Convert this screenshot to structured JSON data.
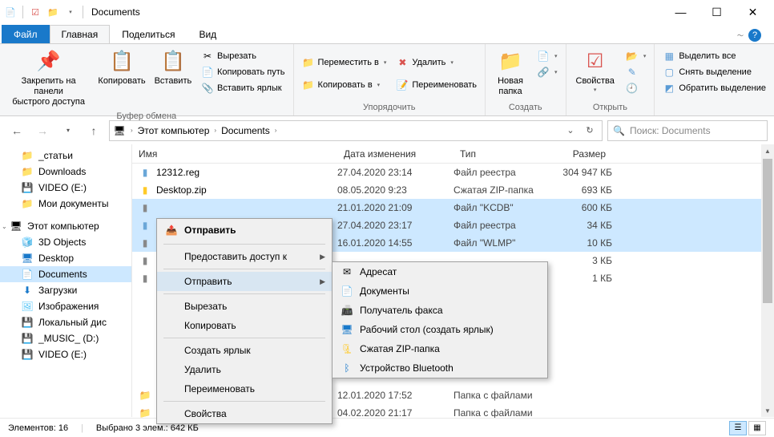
{
  "title": "Documents",
  "tabs": {
    "file": "Файл",
    "home": "Главная",
    "share": "Поделиться",
    "view": "Вид"
  },
  "ribbon": {
    "g1": {
      "pin": "Закрепить на панели\nбыстрого доступа",
      "copy": "Копировать",
      "paste": "Вставить",
      "cut": "Вырезать",
      "copypath": "Копировать путь",
      "pastelink": "Вставить ярлык",
      "label": "Буфер обмена"
    },
    "g2": {
      "moveto": "Переместить в",
      "copyto": "Копировать в",
      "delete": "Удалить",
      "rename": "Переименовать",
      "label": "Упорядочить"
    },
    "g3": {
      "newfolder": "Новая\nпапка",
      "label": "Создать"
    },
    "g4": {
      "props": "Свойства",
      "label": "Открыть"
    },
    "g5": {
      "selall": "Выделить все",
      "selnone": "Снять выделение",
      "selinv": "Обратить выделение"
    }
  },
  "breadcrumb": {
    "pc": "Этот компьютер",
    "docs": "Documents"
  },
  "search_placeholder": "Поиск: Documents",
  "sidebar": {
    "items1": [
      "_статьи",
      "Downloads",
      "VIDEO (E:)",
      "Мои документы"
    ],
    "pc": "Этот компьютер",
    "items2": [
      "3D Objects",
      "Desktop",
      "Documents",
      "Загрузки",
      "Изображения",
      "Локальный дис",
      "_MUSIC_ (D:)",
      "VIDEO (E:)"
    ]
  },
  "headers": {
    "name": "Имя",
    "date": "Дата изменения",
    "type": "Тип",
    "size": "Размер"
  },
  "rows": [
    {
      "name": "12312.reg",
      "date": "27.04.2020 23:14",
      "type": "Файл реестра",
      "size": "304 947 КБ",
      "sel": false,
      "iconc": "#6aa7d8"
    },
    {
      "name": "Desktop.zip",
      "date": "08.05.2020 9:23",
      "type": "Сжатая ZIP-папка",
      "size": "693 КБ",
      "sel": false,
      "iconc": "#ffca28"
    },
    {
      "name": "",
      "date": "21.01.2020 21:09",
      "type": "Файл \"KCDB\"",
      "size": "600 КБ",
      "sel": true,
      "iconc": "#888"
    },
    {
      "name": "",
      "date": "27.04.2020 23:17",
      "type": "Файл реестра",
      "size": "34 КБ",
      "sel": true,
      "iconc": "#6aa7d8"
    },
    {
      "name": "",
      "date": "16.01.2020 14:55",
      "type": "Файл \"WLMP\"",
      "size": "10 КБ",
      "sel": true,
      "iconc": "#888"
    },
    {
      "name": "",
      "date": "",
      "type": "",
      "size": "3 КБ",
      "sel": false,
      "iconc": "#888"
    },
    {
      "name": "",
      "date": "",
      "type": "",
      "size": "1 КБ",
      "sel": false,
      "iconc": "#888"
    }
  ],
  "rows_bottom": [
    {
      "date": "12.01.2020 17:52",
      "type": "Папка с файлами",
      "size": ""
    },
    {
      "date": "04.02.2020 21:17",
      "type": "Папка с файлами",
      "size": ""
    }
  ],
  "context": {
    "title": "Отправить",
    "items": [
      "Предоставить доступ к",
      "Отправить",
      "Вырезать",
      "Копировать",
      "Создать ярлык",
      "Удалить",
      "Переименовать",
      "Свойства"
    ]
  },
  "submenu": [
    "Адресат",
    "Документы",
    "Получатель факса",
    "Рабочий стол (создать ярлык)",
    "Сжатая ZIP-папка",
    "Устройство Bluetooth"
  ],
  "status": {
    "count": "Элементов: 16",
    "sel": "Выбрано 3 элем.:  642 КБ"
  }
}
